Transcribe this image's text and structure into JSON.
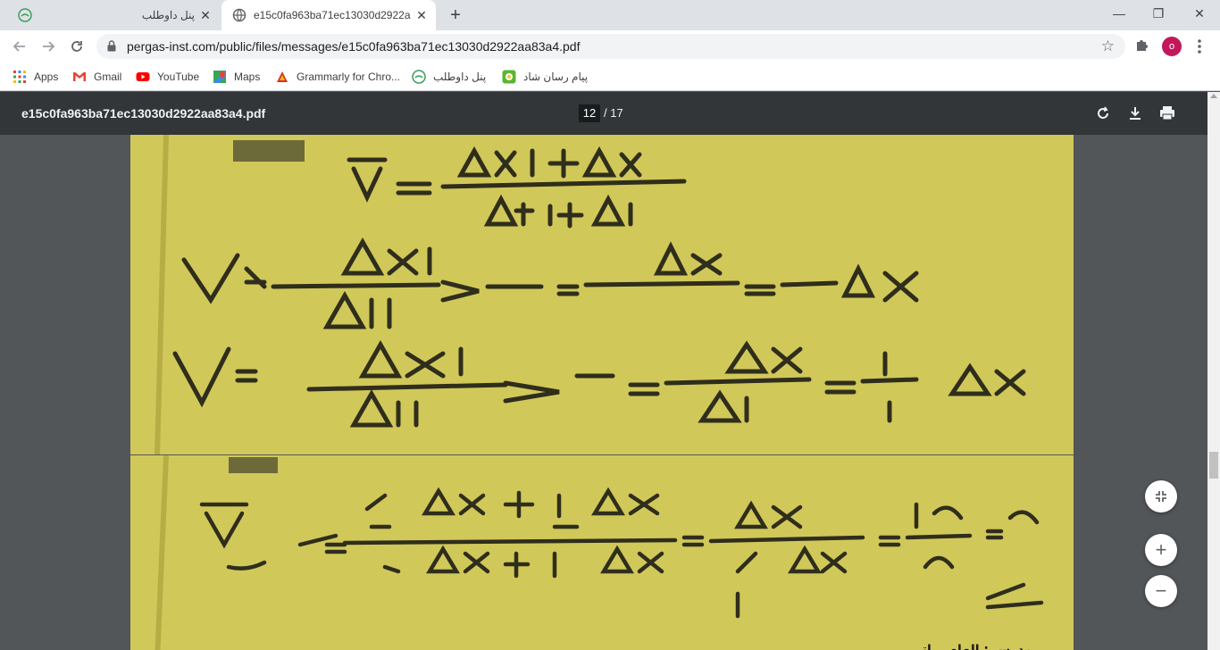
{
  "tabs": [
    {
      "title": "پنل داوطلب",
      "active": false
    },
    {
      "title": "e15c0fa963ba71ec13030d2922aa83a4.pdf",
      "active": true
    }
  ],
  "window": {
    "minimize": "—",
    "restore": "❐",
    "close": "✕",
    "newtab": "+"
  },
  "address_bar": {
    "url": "pergas-inst.com/public/files/messages/e15c0fa963ba71ec13030d2922aa83a4.pdf"
  },
  "profile": {
    "initial": "o",
    "color": "#c2185b"
  },
  "bookmarks": [
    {
      "label": "Apps",
      "icon": "apps-grid-icon"
    },
    {
      "label": "Gmail",
      "icon": "gmail-icon"
    },
    {
      "label": "YouTube",
      "icon": "youtube-icon"
    },
    {
      "label": "Maps",
      "icon": "maps-icon"
    },
    {
      "label": "Grammarly for Chro...",
      "icon": "grammarly-icon"
    },
    {
      "label": "پنل داوطلب",
      "icon": "panel-logo-icon"
    },
    {
      "label": "پیام رسان شاد",
      "icon": "shad-icon"
    }
  ],
  "pdf_viewer": {
    "filename": "e15c0fa963ba71ec13030d2922aa83a4.pdf",
    "current_page": "12",
    "total_pages": "/ 17"
  },
  "document": {
    "caption_partial": "مدرس : الهام براتی"
  },
  "zoom_controls": {
    "fit": "⤡",
    "zoom_in": "+",
    "zoom_out": "−"
  },
  "colors": {
    "tabbar": "#dee1e6",
    "pdf_toolbar": "#323639",
    "viewer_bg": "#525659",
    "photo": "#d1c85a"
  }
}
